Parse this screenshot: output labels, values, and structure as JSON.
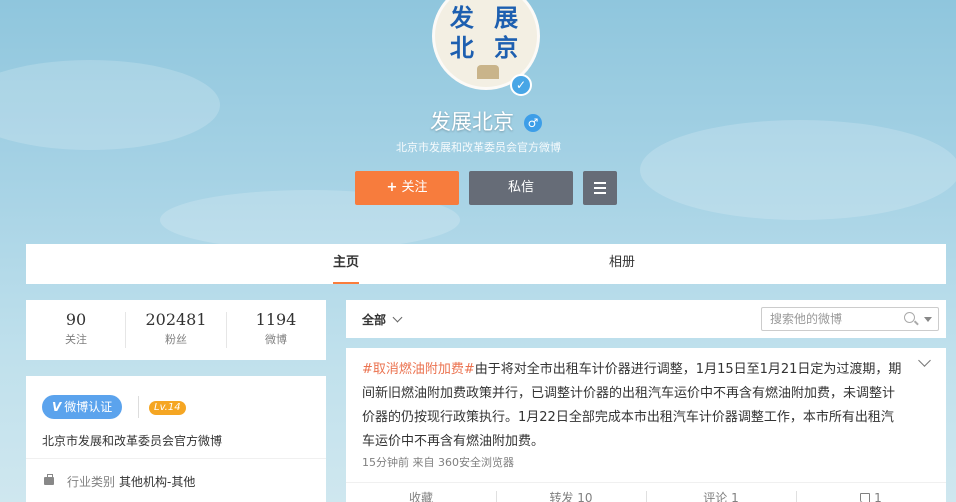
{
  "profile": {
    "avatar_text_line1": "发 展",
    "avatar_text_line2": "北 京",
    "verified_icon": "check",
    "name": "发展北京",
    "gender_icon": "♂",
    "description": "北京市发展和改革委员会官方微博",
    "follow_plus": "+",
    "follow_label": "关注",
    "message_label": "私信"
  },
  "tabs": [
    {
      "label": "主页",
      "active": true
    },
    {
      "label": "相册",
      "active": false
    }
  ],
  "counts": [
    {
      "value": "90",
      "label": "关注"
    },
    {
      "value": "202481",
      "label": "粉丝"
    },
    {
      "value": "1194",
      "label": "微博"
    }
  ],
  "verification": {
    "v_mark": "V",
    "badge_label": "微博认证",
    "level": "Lv.14",
    "description": "北京市发展和改革委员会官方微博",
    "industry_key": "行业类别",
    "industry_value": "其他机构-其他"
  },
  "feed": {
    "filter_label": "全部",
    "search_placeholder": "搜索他的微博"
  },
  "post": {
    "topic": "#取消燃油附加费#",
    "text": "由于将对全市出租车计价器进行调整，1月15日至1月21日定为过渡期，期间新旧燃油附加费政策并行，已调整计价器的出租汽车运价中不再含有燃油附加费，未调整计价器的仍按现行政策执行。1月22日全部完成本市出租汽车计价器调整工作，本市所有出租汽车运价中不再含有燃油附加费。",
    "meta": "15分钟前 来自 360安全浏览器",
    "actions": {
      "favorite": "收藏",
      "repost": "转发 10",
      "comment": "评论 1",
      "like": "1"
    }
  },
  "colors": {
    "accent": "#fa7d3c",
    "follow_button": "#f77c3d",
    "topic": "#eb7350",
    "verified": "#5ba3ed"
  }
}
